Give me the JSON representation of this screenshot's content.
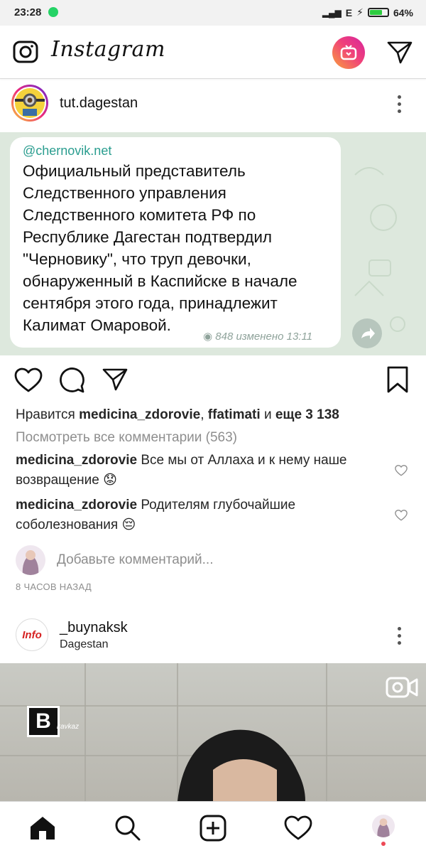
{
  "status": {
    "time": "23:28",
    "network": "E",
    "battery": "64%"
  },
  "app": {
    "logo": "Instagram"
  },
  "post1": {
    "username": "tut.dagestan",
    "bubble": {
      "handle": "@chernovik.net",
      "text": "Официальный представитель Следственного управления Следственного комитета РФ по Республике Дагестан подтвердил \"Черновику\", что труп девочки, обнаруженный в Каспийске в начале сентября этого года, принадлежит Калимат Омаровой.",
      "views": "848",
      "meta": "изменено 13:11"
    },
    "likes": {
      "prefix": "Нравится",
      "user1": "medicina_zdorovie",
      "user2": "ffatimati",
      "and": "и",
      "more": "еще 3 138"
    },
    "view_comments": "Посмотреть все комментарии (563)",
    "comments": [
      {
        "user": "medicina_zdorovie",
        "text": "Все мы от Аллаха и к нему наше возвращение 😟"
      },
      {
        "user": "medicina_zdorovie",
        "text": "Родителям глубочайшие соболезнования 😔"
      }
    ],
    "add_comment_placeholder": "Добавьте комментарий...",
    "time_ago": "8 ЧАСОВ НАЗАД"
  },
  "post2": {
    "username": "_buynaksk",
    "location": "Dagestan",
    "avatar_text": "Info",
    "watermark": "B",
    "watermark_sub": "kavkaz"
  }
}
